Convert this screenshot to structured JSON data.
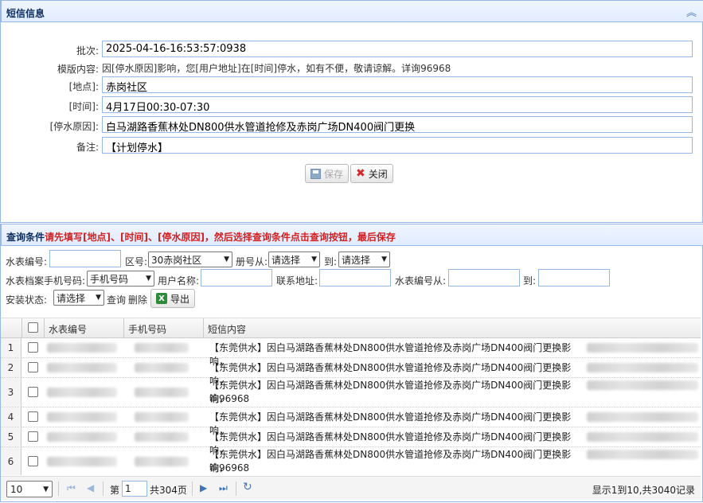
{
  "sms_panel": {
    "title": "短信信息",
    "fields": {
      "batch_label": "批次:",
      "batch_value": "2025-04-16-16:53:57:0938",
      "template_label": "模版内容:",
      "template_value": "因[停水原因]影响，您[用户地址]在[时间]停水，如有不便，敬请谅解。详询96968",
      "location_label": "[地点]:",
      "location_value": "赤岗社区",
      "time_label": "[时间]:",
      "time_value": "4月17日00:30-07:30",
      "reason_label": "[停水原因]:",
      "reason_value": "白马湖路香蕉林处DN800供水管道抢修及赤岗广场DN400阀门更换",
      "note_label": "备注:",
      "note_value": "【计划停水】"
    },
    "buttons": {
      "save": "保存",
      "close": "关闭"
    }
  },
  "query_panel": {
    "title_blue": "查询条件",
    "title_red": "请先填写[地点]、[时间]、[停水原因]，然后选择查询条件点击查询按钮，最后保存",
    "meter_no_label": "水表编号:",
    "district_label": "区号:",
    "district_value": "30赤岗社区",
    "book_from_label": "册号从:",
    "book_from_value": "请选择",
    "to_label": "到:",
    "book_to_value": "请选择",
    "phone_label": "水表档案手机号码:",
    "phone_value": "手机号码",
    "username_label": "用户名称:",
    "address_label": "联系地址:",
    "meter_from_label": "水表编号从:",
    "meter_to_label": "到:",
    "install_label": "安装状态:",
    "install_value": "请选择",
    "query_link": "查询",
    "delete_link": "删除",
    "export_label": "导出"
  },
  "grid": {
    "headers": [
      "水表编号",
      "手机号码",
      "短信内容"
    ],
    "rows": [
      {
        "num": "1",
        "sms": "【东莞供水】因白马湖路香蕉林处DN800供水管道抢修及赤岗广场DN400阀门更换影响，"
      },
      {
        "num": "2",
        "sms": "【东莞供水】因白马湖路香蕉林处DN800供水管道抢修及赤岗广场DN400阀门更换影响，"
      },
      {
        "num": "3",
        "sms": "【东莞供水】因白马湖路香蕉林处DN800供水管道抢修及赤岗广场DN400阀门更换影响，",
        "sms2": "询96968"
      },
      {
        "num": "4",
        "sms": "【东莞供水】因白马湖路香蕉林处DN800供水管道抢修及赤岗广场DN400阀门更换影响，"
      },
      {
        "num": "5",
        "sms": "【东莞供水】因白马湖路香蕉林处DN800供水管道抢修及赤岗广场DN400阀门更换影响，"
      },
      {
        "num": "6",
        "sms": "【东莞供水】因白马湖路香蕉林处DN800供水管道抢修及赤岗广场DN400阀门更换影响，",
        "sms2": "询96968"
      }
    ]
  },
  "pager": {
    "page_size": "10",
    "page_prefix": "第",
    "page_value": "1",
    "page_suffix": "共304页",
    "summary": "显示1到10,共3040记录"
  }
}
